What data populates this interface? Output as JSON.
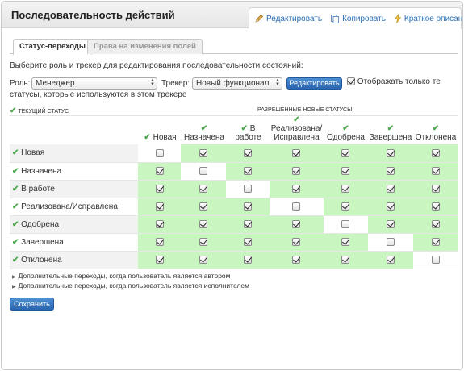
{
  "header": {
    "title": "Последовательность действий"
  },
  "actions": [
    {
      "label": "Редактировать",
      "icon": "pencil-icon",
      "icon_color": "#d9a13b"
    },
    {
      "label": "Копировать",
      "icon": "copy-icon",
      "icon_color": "#5b84c4"
    },
    {
      "label": "Краткое описание",
      "icon": "lightning-icon",
      "icon_color": "#e8b923"
    }
  ],
  "tabs": [
    {
      "label": "Статус-переходы",
      "active": true
    },
    {
      "label": "Права на изменения полей",
      "active": false
    }
  ],
  "intro": "Выберите роль и трекер для редактирования последовательности состояний:",
  "filters": {
    "role_label": "Роль:",
    "role_value": "Менеджер",
    "tracker_label": "Трекер:",
    "tracker_value": "Новый функционал",
    "edit_button": "Редактировать",
    "only_used_label": "Отображать только те",
    "only_used_label_2": "статусы, которые используются в этом трекере",
    "only_used_checked": true
  },
  "matrix": {
    "current_label": "Текущий статус",
    "allowed_label": "Разрешенные новые статусы",
    "columns": [
      "Новая",
      "Назначена",
      "В работе",
      "Реализована/Исправлена",
      "Одобрена",
      "Завершена",
      "Отклонена"
    ],
    "column_lines": [
      [
        "Новая"
      ],
      [
        "",
        "Назначена"
      ],
      [
        "В",
        "работе"
      ],
      [
        "Реализована/",
        "Исправлена"
      ],
      [
        "Одобрена"
      ],
      [
        "Завершена"
      ],
      [
        "Отклонена"
      ]
    ],
    "rows": [
      {
        "status": "Новая",
        "values": [
          false,
          true,
          true,
          true,
          true,
          true,
          true
        ]
      },
      {
        "status": "Назначена",
        "values": [
          true,
          false,
          true,
          true,
          true,
          true,
          true
        ]
      },
      {
        "status": "В работе",
        "values": [
          true,
          true,
          false,
          true,
          true,
          true,
          true
        ]
      },
      {
        "status": "Реализована/Исправлена",
        "values": [
          true,
          true,
          true,
          false,
          true,
          true,
          true
        ]
      },
      {
        "status": "Одобрена",
        "values": [
          true,
          true,
          true,
          true,
          false,
          true,
          true
        ]
      },
      {
        "status": "Завершена",
        "values": [
          true,
          true,
          true,
          true,
          true,
          false,
          true
        ]
      },
      {
        "status": "Отклонена",
        "values": [
          true,
          true,
          true,
          true,
          true,
          true,
          false
        ]
      }
    ],
    "allowed_color": "#c8f5c0"
  },
  "extras": [
    "Дополнительные переходы, когда пользователь является автором",
    "Дополнительные переходы, когда пользователь является исполнителем"
  ],
  "save_button": "Сохранить"
}
